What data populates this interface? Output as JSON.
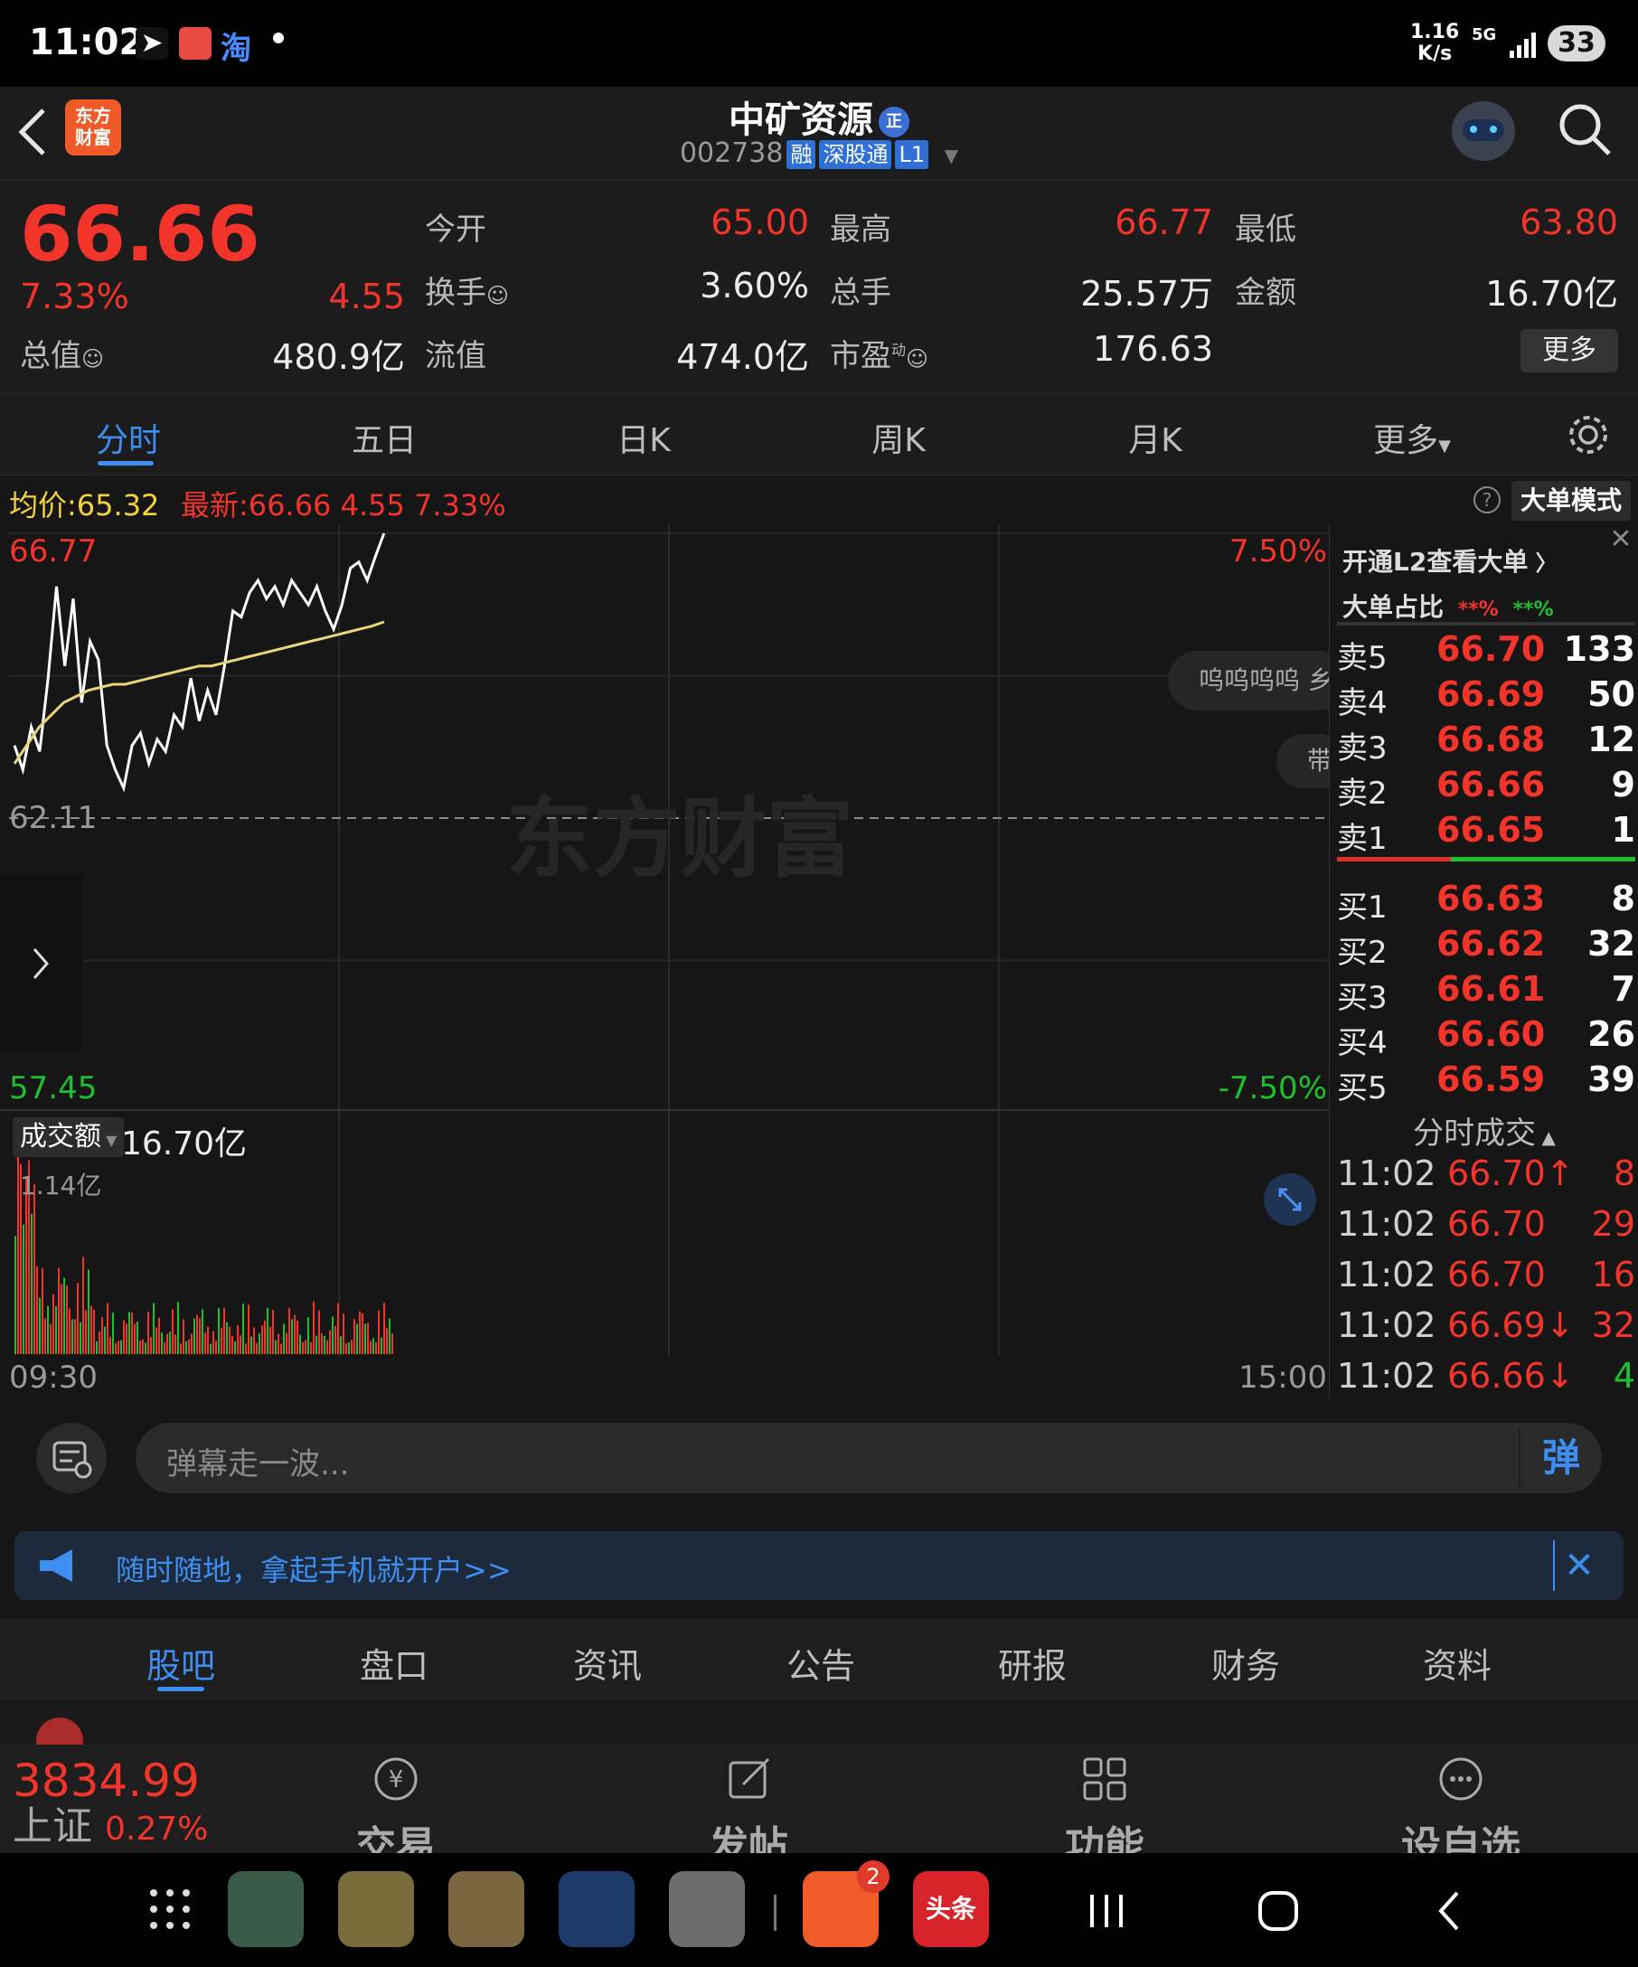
{
  "status_bar": {
    "time": "11:02",
    "net_speed_value": "1.16",
    "net_speed_unit": "K/s",
    "network": "5G",
    "battery": "33"
  },
  "header": {
    "logo_text": "东方\n财富",
    "stock_name": "中矿资源",
    "stock_badge": "正",
    "stock_code": "002738",
    "tags": [
      "融",
      "深股通",
      "L1"
    ]
  },
  "quote": {
    "price": "66.66",
    "change_pct": "7.33%",
    "change": "4.55",
    "open_label": "今开",
    "open": "65.00",
    "high_label": "最高",
    "high": "66.77",
    "low_label": "最低",
    "low": "63.80",
    "turnover_label": "换手",
    "turnover": "3.60%",
    "volume_label": "总手",
    "volume": "25.57万",
    "amount_label": "金额",
    "amount": "16.70亿",
    "mktcap_label": "总值",
    "mktcap": "480.9亿",
    "float_label": "流值",
    "float": "474.0亿",
    "pe_label": "市盈",
    "pe_sup": "动",
    "pe": "176.63",
    "more": "更多"
  },
  "kline_tabs": [
    "分时",
    "五日",
    "日K",
    "周K",
    "月K",
    "更多"
  ],
  "info_line": {
    "avg_label": "均价:",
    "avg": "65.32",
    "latest_label": "最新:",
    "latest": "66.66",
    "change": "4.55",
    "change_pct": "7.33%",
    "mode_button": "大单模式"
  },
  "chart": {
    "high_label": "66.77",
    "low_label": "57.45",
    "mid_label": "62.11",
    "pct_high": "7.50%",
    "pct_low": "-7.50%",
    "watermark": "东方财富",
    "danmu1": "呜呜呜呜 乡",
    "danmu2": "带",
    "volume_selector": "成交额",
    "volume_total": "16.70亿",
    "volume_max": "1.14亿",
    "time_start": "09:30",
    "time_end": "15:00"
  },
  "chart_data": {
    "type": "line",
    "title": "",
    "x_range": [
      "09:30",
      "15:00"
    ],
    "ylim": [
      57.45,
      66.77
    ],
    "prev_close": 62.11,
    "series": [
      {
        "values": [
          63.3,
          62.9,
          63.6,
          63.2,
          64.4,
          65.9,
          64.6,
          65.7,
          64.0,
          65.0,
          64.7,
          63.3,
          62.9,
          62.6,
          63.3,
          63.5,
          63.0,
          63.4,
          63.2,
          63.8,
          63.6,
          64.4,
          63.7,
          64.2,
          63.8,
          64.6,
          65.5,
          65.4,
          65.8,
          66.0,
          65.7,
          65.9,
          65.6,
          66.0,
          65.8,
          65.6,
          65.9,
          65.5,
          65.2,
          65.6,
          66.2,
          66.3,
          66.0,
          66.4,
          66.77
        ]
      },
      {
        "values": [
          63.0,
          63.3,
          63.6,
          63.8,
          64.0,
          64.1,
          64.2,
          64.25,
          64.3,
          64.3,
          64.35,
          64.4,
          64.45,
          64.5,
          64.55,
          64.6,
          64.6,
          64.65,
          64.7,
          64.75,
          64.8,
          64.85,
          64.9,
          64.95,
          65.0,
          65.05,
          65.1,
          65.15,
          65.2,
          65.25,
          65.32
        ]
      }
    ],
    "volume_max_label": "1.14亿"
  },
  "orderbook": {
    "header": "开通L2查看大单",
    "ratio_label": "大单占比",
    "ratio_red": "**%",
    "ratio_green": "**%",
    "asks": [
      {
        "label": "卖5",
        "price": "66.70",
        "vol": "133"
      },
      {
        "label": "卖4",
        "price": "66.69",
        "vol": "50"
      },
      {
        "label": "卖3",
        "price": "66.68",
        "vol": "12"
      },
      {
        "label": "卖2",
        "price": "66.66",
        "vol": "9"
      },
      {
        "label": "卖1",
        "price": "66.65",
        "vol": "1"
      }
    ],
    "bids": [
      {
        "label": "买1",
        "price": "66.63",
        "vol": "8"
      },
      {
        "label": "买2",
        "price": "66.62",
        "vol": "32"
      },
      {
        "label": "买3",
        "price": "66.61",
        "vol": "7"
      },
      {
        "label": "买4",
        "price": "66.60",
        "vol": "26"
      },
      {
        "label": "买5",
        "price": "66.59",
        "vol": "39"
      }
    ],
    "trades_header": "分时成交",
    "trades": [
      {
        "time": "11:02",
        "price": "66.70↑",
        "vol": "8"
      },
      {
        "time": "11:02",
        "price": "66.70",
        "vol": "29"
      },
      {
        "time": "11:02",
        "price": "66.70",
        "vol": "16"
      },
      {
        "time": "11:02",
        "price": "66.69↓",
        "vol": "32"
      },
      {
        "time": "11:02",
        "price": "66.66↓",
        "vol": "4"
      }
    ]
  },
  "danmu_input": {
    "placeholder": "弹幕走一波...",
    "send_icon_text": "弹"
  },
  "promo": {
    "text": "随时随地，拿起手机就开户>>"
  },
  "bottom_tabs": [
    "股吧",
    "盘口",
    "资讯",
    "公告",
    "研报",
    "财务",
    "资料"
  ],
  "index": {
    "value": "3834.99",
    "name": "上证",
    "change": "0.27%"
  },
  "toolbar": [
    {
      "label": "交易",
      "icon": "yen-icon"
    },
    {
      "label": "发帖",
      "icon": "edit-icon"
    },
    {
      "label": "功能",
      "icon": "grid-icon"
    },
    {
      "label": "设自选",
      "icon": "more-icon"
    }
  ],
  "navbar": {
    "badge": "2",
    "toutiao": "头条"
  },
  "colors": {
    "up": "#f2342a",
    "down": "#1ec02f",
    "accent": "#3d8ef0",
    "avg_line": "#e8d57a"
  }
}
